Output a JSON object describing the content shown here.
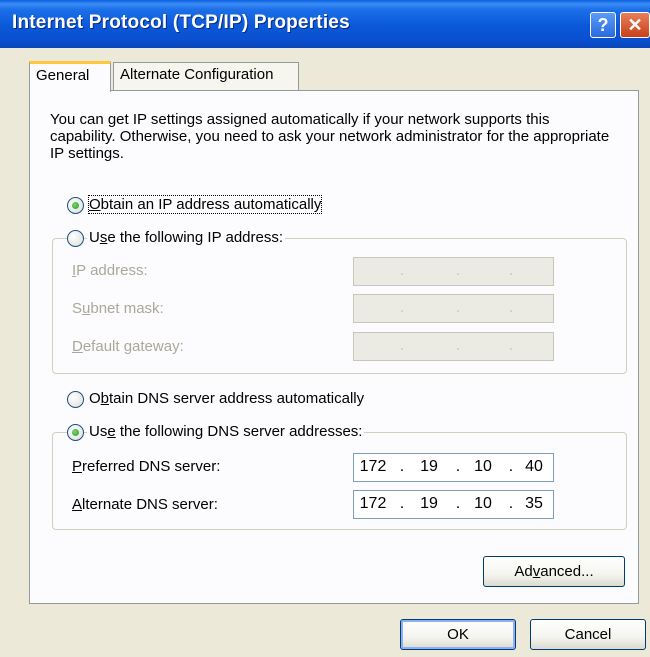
{
  "window": {
    "title": "Internet Protocol (TCP/IP) Properties",
    "help_glyph": "?",
    "close_glyph": "✕"
  },
  "tabs": [
    {
      "label": "General",
      "active": true
    },
    {
      "label": "Alternate Configuration",
      "active": false
    }
  ],
  "description": "You can get IP settings assigned automatically if your network supports this capability. Otherwise, you need to ask your network administrator for the appropriate IP settings.",
  "ip_options": {
    "auto": {
      "pre": "",
      "mnemonic": "O",
      "post": "btain an IP address automatically",
      "checked": true
    },
    "manual": {
      "pre": "U",
      "mnemonic": "s",
      "post": "e the following IP address:",
      "checked": false
    }
  },
  "ip_fields": [
    {
      "pre": "",
      "mnemonic": "I",
      "post": "P address:",
      "octets": [
        "",
        "",
        "",
        ""
      ],
      "enabled": false
    },
    {
      "pre": "S",
      "mnemonic": "u",
      "post": "bnet mask:",
      "octets": [
        "",
        "",
        "",
        ""
      ],
      "enabled": false
    },
    {
      "pre": "",
      "mnemonic": "D",
      "post": "efault gateway:",
      "octets": [
        "",
        "",
        "",
        ""
      ],
      "enabled": false
    }
  ],
  "dns_options": {
    "auto": {
      "pre": "O",
      "mnemonic": "b",
      "post": "tain DNS server address automatically",
      "checked": false
    },
    "manual": {
      "pre": "Us",
      "mnemonic": "e",
      "post": " the following DNS server addresses:",
      "checked": true
    }
  },
  "dns_fields": [
    {
      "pre": "",
      "mnemonic": "P",
      "post": "referred DNS server:",
      "octets": [
        "172",
        "19",
        "10",
        "40"
      ],
      "enabled": true
    },
    {
      "pre": "",
      "mnemonic": "A",
      "post": "lternate DNS server:",
      "octets": [
        "172",
        "19",
        "10",
        "35"
      ],
      "enabled": true
    }
  ],
  "buttons": {
    "advanced": {
      "pre": "Ad",
      "mnemonic": "v",
      "post": "anced..."
    },
    "ok": "OK",
    "cancel": "Cancel"
  },
  "colors": {
    "titlebar": "#0a58d8",
    "dialog_bg": "#ece9d8",
    "panel_bg": "#fcfcfe",
    "active_tab_accent": "#ffc83c",
    "radio_dot": "#21a121"
  }
}
